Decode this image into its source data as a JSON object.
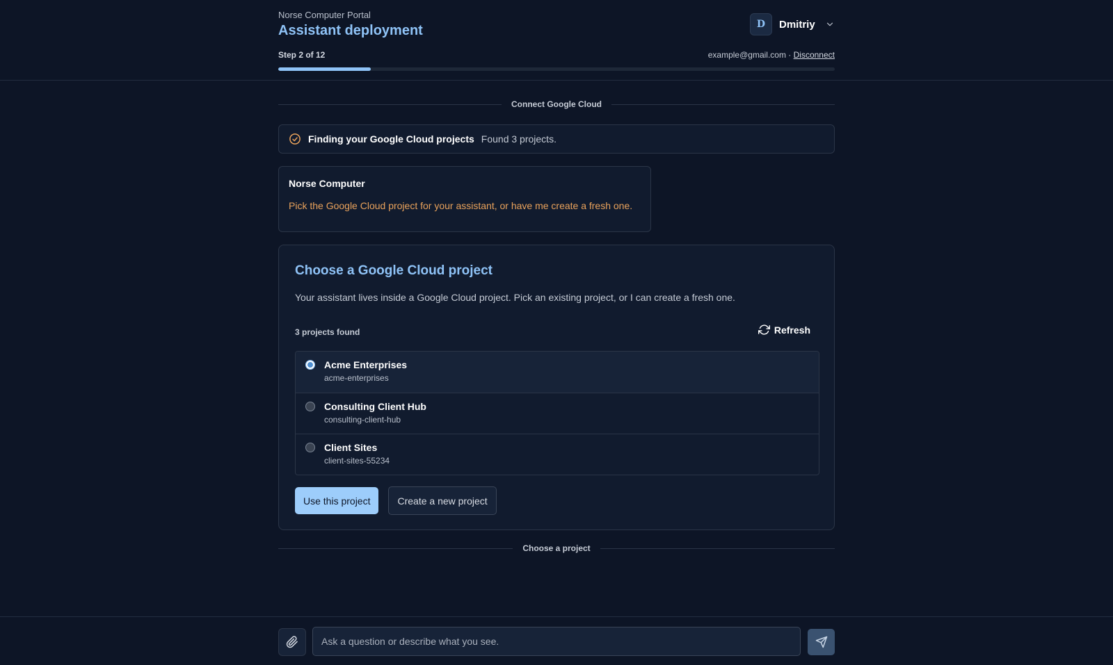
{
  "header": {
    "portal_name": "Norse Computer Portal",
    "title": "Assistant deployment",
    "step_text": "Step 2 of 12",
    "progress": {
      "current": 2,
      "total": 12
    },
    "user": {
      "initial": "D",
      "name": "Dmitriy"
    },
    "account": {
      "email": "example@gmail.com",
      "separator": " · ",
      "disconnect_label": "Disconnect"
    }
  },
  "section_top_label": "Connect Google Cloud",
  "status": {
    "title": "Finding your Google Cloud projects",
    "message": "Found 3 projects."
  },
  "assistant_message": {
    "author": "Norse Computer",
    "text": "Pick the Google Cloud project for your assistant, or have me create a fresh one."
  },
  "card": {
    "title": "Choose a Google Cloud project",
    "description": "Your assistant lives inside a Google Cloud project. Pick an existing project, or I can create a fresh one.",
    "count_text": "3 projects found",
    "refresh_label": "Refresh",
    "projects": [
      {
        "name": "Acme Enterprises",
        "id": "acme-enterprises",
        "selected": true
      },
      {
        "name": "Consulting Client Hub",
        "id": "consulting-client-hub",
        "selected": false
      },
      {
        "name": "Client Sites",
        "id": "client-sites-55234",
        "selected": false
      }
    ],
    "primary_label": "Use this project",
    "secondary_label": "Create a new project"
  },
  "section_bottom_label": "Choose a project",
  "composer": {
    "placeholder": "Ask a question or describe what you see."
  },
  "colors": {
    "background": "#0d1526",
    "accent": "#8fc3f7",
    "assistant_text": "#e9a25b",
    "status_icon": "#e9a25b"
  }
}
